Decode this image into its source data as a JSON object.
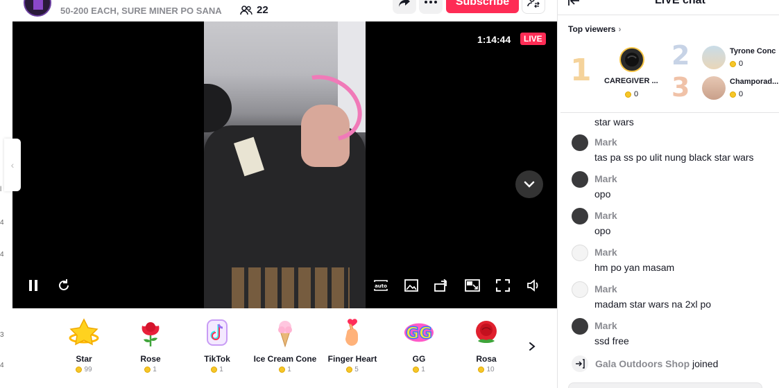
{
  "header": {
    "host_subtitle": "50-200 EACH, SURE MINER PO SANA",
    "viewer_count": "22",
    "subscribe_label": "Subscribe"
  },
  "video": {
    "timer": "1:14:44",
    "live_badge": "LIVE"
  },
  "gifts": [
    {
      "name": "Star",
      "price": "99",
      "icon": "star-gift-icon"
    },
    {
      "name": "Rose",
      "price": "1",
      "icon": "rose-gift-icon"
    },
    {
      "name": "TikTok",
      "price": "1",
      "icon": "tiktok-gift-icon"
    },
    {
      "name": "Ice Cream Cone",
      "price": "1",
      "icon": "ice-cream-gift-icon"
    },
    {
      "name": "Finger Heart",
      "price": "5",
      "icon": "finger-heart-gift-icon"
    },
    {
      "name": "GG",
      "price": "1",
      "icon": "gg-gift-icon"
    },
    {
      "name": "Rosa",
      "price": "10",
      "icon": "rosa-gift-icon"
    }
  ],
  "chat": {
    "title": "LIVE chat",
    "top_viewers_label": "Top viewers",
    "top_viewers": [
      {
        "rank": "1",
        "name": "CAREGIVER ...",
        "score": "0"
      },
      {
        "rank": "2",
        "name": "Tyrone Conc",
        "score": "0"
      },
      {
        "rank": "3",
        "name": "Champorad...",
        "score": "0"
      }
    ],
    "previous_message": "star wars",
    "messages": [
      {
        "user": "Mark",
        "text": "tas pa ss po ulit nung black star wars"
      },
      {
        "user": "Mark",
        "text": "opo"
      },
      {
        "user": "Mark",
        "text": "opo"
      },
      {
        "user": "Mark",
        "text": "hm po yan masam"
      },
      {
        "user": "Mark",
        "text": "madam star wars na 2xl po"
      },
      {
        "user": "Mark",
        "text": "ssd free"
      }
    ],
    "joined_user": "Gala Outdoors Shop",
    "joined_suffix": " joined"
  },
  "colors": {
    "accent": "#fe2c55",
    "rank1": "#f5d39b",
    "rank2": "#c7d3e6",
    "rank3": "#f0c2a8"
  }
}
